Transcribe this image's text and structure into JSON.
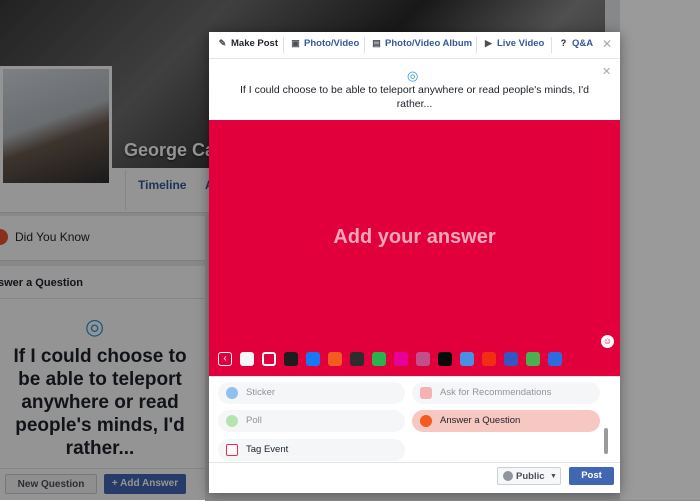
{
  "profile": {
    "name": "George Ca",
    "tabs": [
      "Timeline",
      "A"
    ]
  },
  "sidebar": {
    "did_you_know": "Did You Know",
    "answer_header": "swer a Question",
    "question": "If I could choose to be able to teleport anywhere or read people's minds, I'd rather...",
    "new_question": "New Question",
    "add_answer": "+ Add Answer"
  },
  "dialog": {
    "tabs": [
      {
        "label": "Make Post",
        "icon": "pencil-icon"
      },
      {
        "label": "Photo/Video",
        "icon": "camera-icon"
      },
      {
        "label": "Photo/Video Album",
        "icon": "album-icon"
      },
      {
        "label": "Live Video",
        "icon": "video-icon"
      },
      {
        "label": "Q&A",
        "icon": "question-icon"
      }
    ],
    "question": "If I could choose to be able to teleport anywhere or read people's minds, I'd rather...",
    "answer_placeholder": "Add your answer",
    "answer_bg": "#e2003c",
    "swatches": [
      "#f5f6f7",
      "#e2003c",
      "#1d1d1d",
      "#1877f2",
      "#f35b1f",
      "#2d2d2d",
      "#2ab24d",
      "#e5009b",
      "#c14f8a",
      "#0a0a0a",
      "#4a90e2",
      "#f02e14",
      "#3755c0",
      "#4caf50",
      "#2d6be0"
    ],
    "options": [
      {
        "label": "Sticker",
        "icon": "sticker-icon",
        "color": "#4a90e2"
      },
      {
        "label": "Ask for Recommendations",
        "icon": "recommendations-icon",
        "color": "#f08a8a"
      },
      {
        "label": "Poll",
        "icon": "poll-icon",
        "color": "#7ccf73"
      },
      {
        "label": "Answer a Question",
        "icon": "answer-icon",
        "color": "#f35b1f"
      },
      {
        "label": "Tag Event",
        "icon": "calendar-icon",
        "color": "#f02849"
      }
    ],
    "privacy": "Public",
    "post": "Post"
  }
}
